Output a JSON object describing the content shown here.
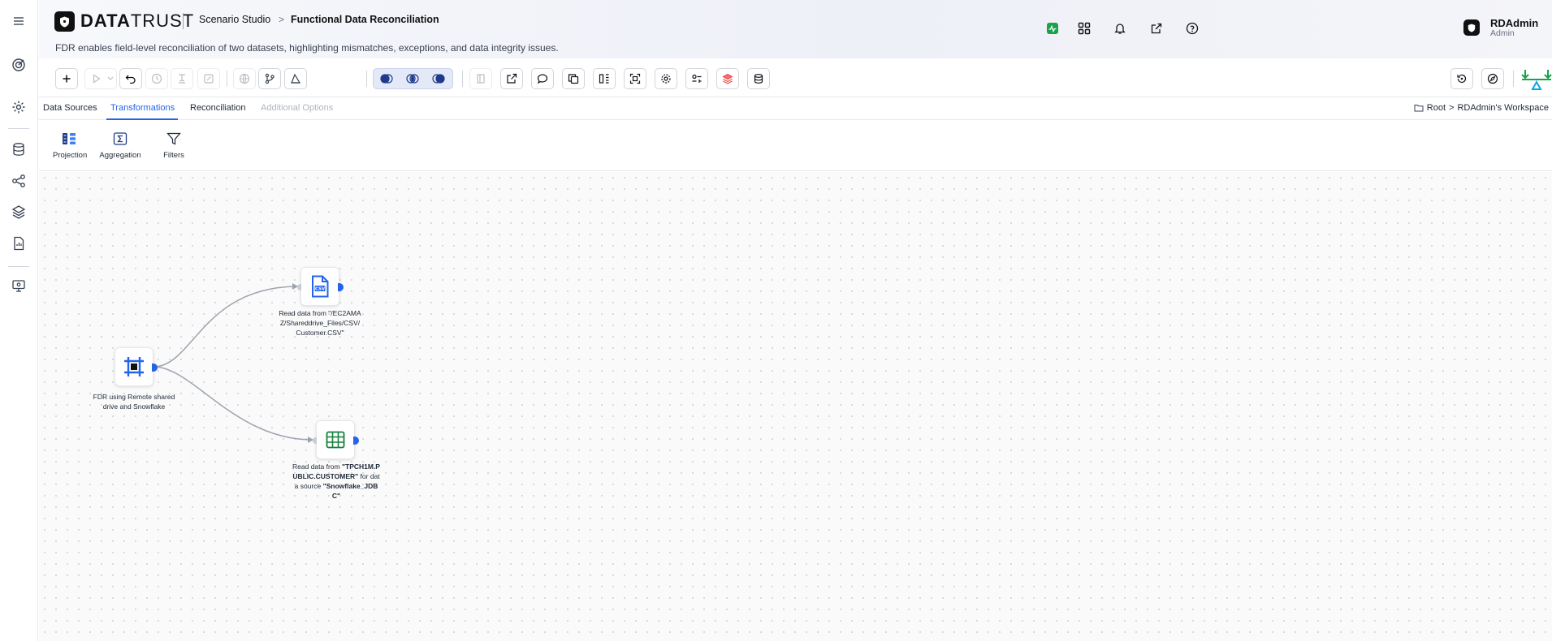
{
  "app": {
    "brand_bold": "DATA",
    "brand_light": "TRUST",
    "breadcrumb": [
      "Scenario Studio",
      "Functional Data Reconciliation"
    ],
    "breadcrumb_separator": ">",
    "subtitle": "FDR enables field-level reconciliation of two datasets, highlighting mismatches, exceptions, and data integrity issues."
  },
  "user": {
    "name": "RDAdmin",
    "role": "Admin"
  },
  "rail_icons": [
    "menu-icon",
    "target-icon",
    "gear-icon",
    "database-icon",
    "share-nodes-icon",
    "layers-icon",
    "report-icon",
    "monitor-icon"
  ],
  "header_icons": [
    "activity-icon",
    "apps-grid-icon",
    "bell-icon",
    "external-link-icon",
    "help-icon"
  ],
  "tabs": [
    {
      "label": "Data Sources",
      "state": "normal"
    },
    {
      "label": "Transformations",
      "state": "active"
    },
    {
      "label": "Reconciliation",
      "state": "normal"
    },
    {
      "label": "Additional Options",
      "state": "disabled"
    }
  ],
  "workspace": {
    "root": "Root",
    "separator": ">",
    "name": "RDAdmin's Workspace"
  },
  "palette": [
    {
      "label": "Projection",
      "icon": "projection-icon"
    },
    {
      "label": "Aggregation",
      "icon": "sigma-icon"
    },
    {
      "label": "Filters",
      "icon": "filter-icon"
    }
  ],
  "nodes": {
    "root": {
      "label": "FDR using Remote shared drive and Snowflake",
      "icon": "scenario-icon"
    },
    "csv": {
      "label": "Read data from \"/EC2AMAZ/Shareddrive_Files/CSV/Customer.CSV\"",
      "icon": "csv-file-icon"
    },
    "table": {
      "label_prefix": "Read data from ",
      "table_name": "\"TPCH1M.PUBLIC.CUSTOMER\"",
      "label_middle": " for data source ",
      "source_name": "\"Snowflake_JDBC\"",
      "icon": "table-icon"
    }
  },
  "colors": {
    "accent": "#2563eb",
    "active_tab": "#2563eb",
    "brand_green": "#16a34a",
    "node_table_green": "#15803d"
  }
}
